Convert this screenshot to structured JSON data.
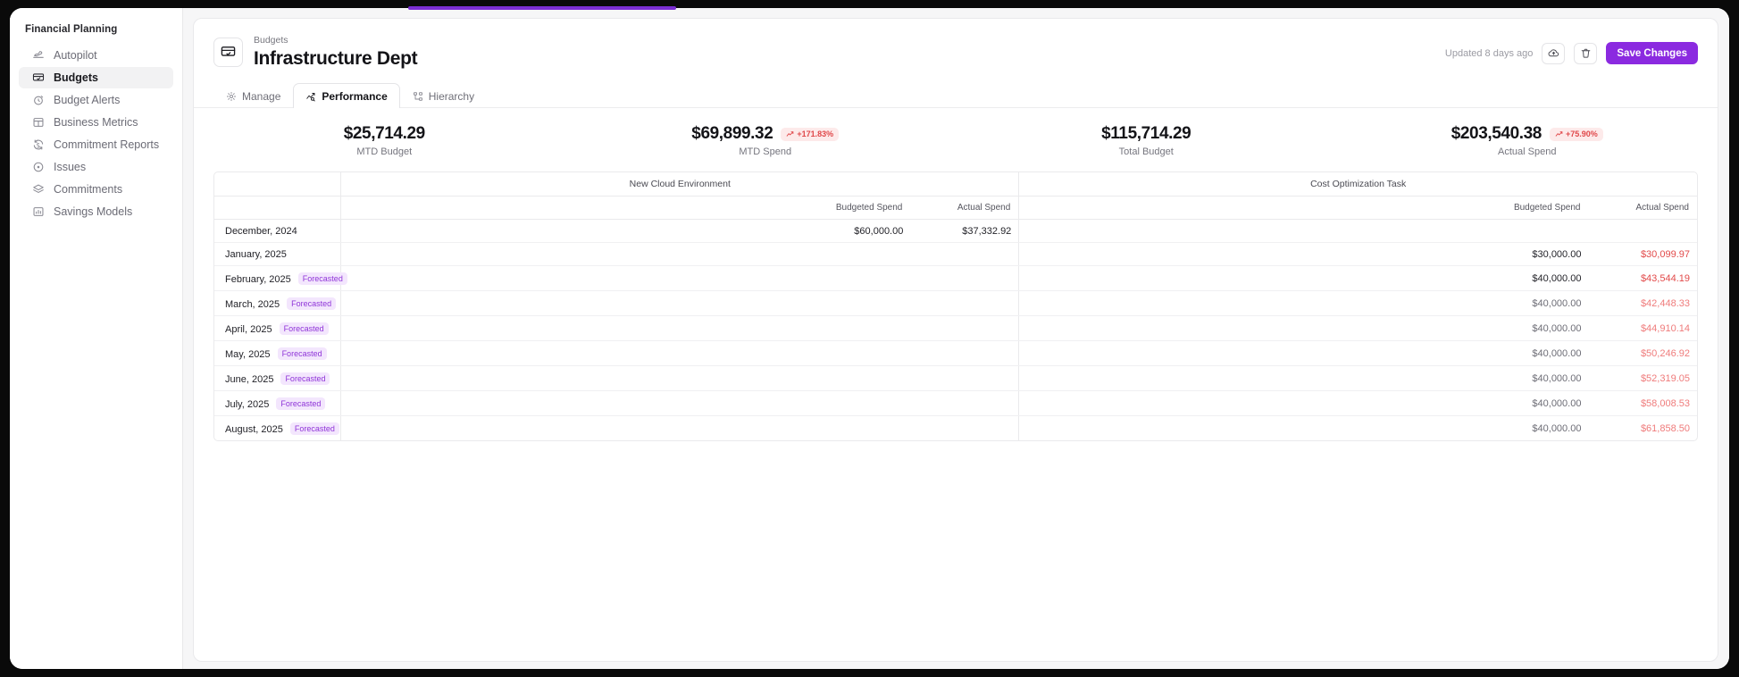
{
  "sidebar": {
    "title": "Financial Planning",
    "items": [
      {
        "label": "Autopilot",
        "icon": "plane-icon",
        "active": false
      },
      {
        "label": "Budgets",
        "icon": "budget-icon",
        "active": true
      },
      {
        "label": "Budget Alerts",
        "icon": "alert-clock-icon",
        "active": false
      },
      {
        "label": "Business Metrics",
        "icon": "grid-icon",
        "active": false
      },
      {
        "label": "Commitment Reports",
        "icon": "refresh-s-icon",
        "active": false
      },
      {
        "label": "Issues",
        "icon": "target-icon",
        "active": false
      },
      {
        "label": "Commitments",
        "icon": "layers-icon",
        "active": false
      },
      {
        "label": "Savings Models",
        "icon": "bar-chart-icon",
        "active": false
      }
    ]
  },
  "header": {
    "breadcrumb": "Budgets",
    "title": "Infrastructure Dept",
    "title_icon": "budget-icon",
    "updated": "Updated 8 days ago",
    "cloud_button_icon": "cloud-upload-icon",
    "delete_button_icon": "trash-icon",
    "save_label": "Save Changes",
    "accent_color": "#8b2ae0"
  },
  "tabs": [
    {
      "label": "Manage",
      "icon": "gear-icon",
      "active": false
    },
    {
      "label": "Performance",
      "icon": "trend-icon",
      "active": true
    },
    {
      "label": "Hierarchy",
      "icon": "hierarchy-icon",
      "active": false
    }
  ],
  "stats": [
    {
      "value": "$25,714.29",
      "label": "MTD Budget",
      "badge": null,
      "badge_icon": null
    },
    {
      "value": "$69,899.32",
      "label": "MTD Spend",
      "badge": "+171.83%",
      "badge_icon": "trend-up-icon"
    },
    {
      "value": "$115,714.29",
      "label": "Total Budget",
      "badge": null,
      "badge_icon": null
    },
    {
      "value": "$203,540.38",
      "label": "Actual Spend",
      "badge": "+75.90%",
      "badge_icon": "trend-up-icon"
    }
  ],
  "table": {
    "groups": [
      {
        "name": "New Cloud Environment",
        "sub": [
          "Budgeted Spend",
          "Actual Spend"
        ]
      },
      {
        "name": "Cost Optimization Task",
        "sub": [
          "Budgeted Spend",
          "Actual Spend"
        ]
      }
    ],
    "forecast_badge_label": "Forecasted",
    "rows": [
      {
        "month": "December, 2024",
        "forecasted": false,
        "g1_budget": "$60,000.00",
        "g1_actual": "$37,332.92",
        "g1_actual_over": false,
        "g1_muted": false,
        "g2_budget": "",
        "g2_actual": "",
        "g2_actual_over": false,
        "g2_muted": false
      },
      {
        "month": "January, 2025",
        "forecasted": false,
        "g1_budget": "",
        "g1_actual": "",
        "g1_actual_over": false,
        "g1_muted": false,
        "g2_budget": "$30,000.00",
        "g2_actual": "$30,099.97",
        "g2_actual_over": true,
        "g2_muted": false
      },
      {
        "month": "February, 2025",
        "forecasted": true,
        "g1_budget": "",
        "g1_actual": "",
        "g1_actual_over": false,
        "g1_muted": false,
        "g2_budget": "$40,000.00",
        "g2_actual": "$43,544.19",
        "g2_actual_over": true,
        "g2_muted": false
      },
      {
        "month": "March, 2025",
        "forecasted": true,
        "g1_budget": "",
        "g1_actual": "",
        "g1_actual_over": false,
        "g1_muted": false,
        "g2_budget": "$40,000.00",
        "g2_actual": "$42,448.33",
        "g2_actual_over": true,
        "g2_muted": true
      },
      {
        "month": "April, 2025",
        "forecasted": true,
        "g1_budget": "",
        "g1_actual": "",
        "g1_actual_over": false,
        "g1_muted": false,
        "g2_budget": "$40,000.00",
        "g2_actual": "$44,910.14",
        "g2_actual_over": true,
        "g2_muted": true
      },
      {
        "month": "May, 2025",
        "forecasted": true,
        "g1_budget": "",
        "g1_actual": "",
        "g1_actual_over": false,
        "g1_muted": false,
        "g2_budget": "$40,000.00",
        "g2_actual": "$50,246.92",
        "g2_actual_over": true,
        "g2_muted": true
      },
      {
        "month": "June, 2025",
        "forecasted": true,
        "g1_budget": "",
        "g1_actual": "",
        "g1_actual_over": false,
        "g1_muted": false,
        "g2_budget": "$40,000.00",
        "g2_actual": "$52,319.05",
        "g2_actual_over": true,
        "g2_muted": true
      },
      {
        "month": "July, 2025",
        "forecasted": true,
        "g1_budget": "",
        "g1_actual": "",
        "g1_actual_over": false,
        "g1_muted": false,
        "g2_budget": "$40,000.00",
        "g2_actual": "$58,008.53",
        "g2_actual_over": true,
        "g2_muted": true
      },
      {
        "month": "August, 2025",
        "forecasted": true,
        "g1_budget": "",
        "g1_actual": "",
        "g1_actual_over": false,
        "g1_muted": false,
        "g2_budget": "$40,000.00",
        "g2_actual": "$61,858.50",
        "g2_actual_over": true,
        "g2_muted": true
      }
    ]
  }
}
